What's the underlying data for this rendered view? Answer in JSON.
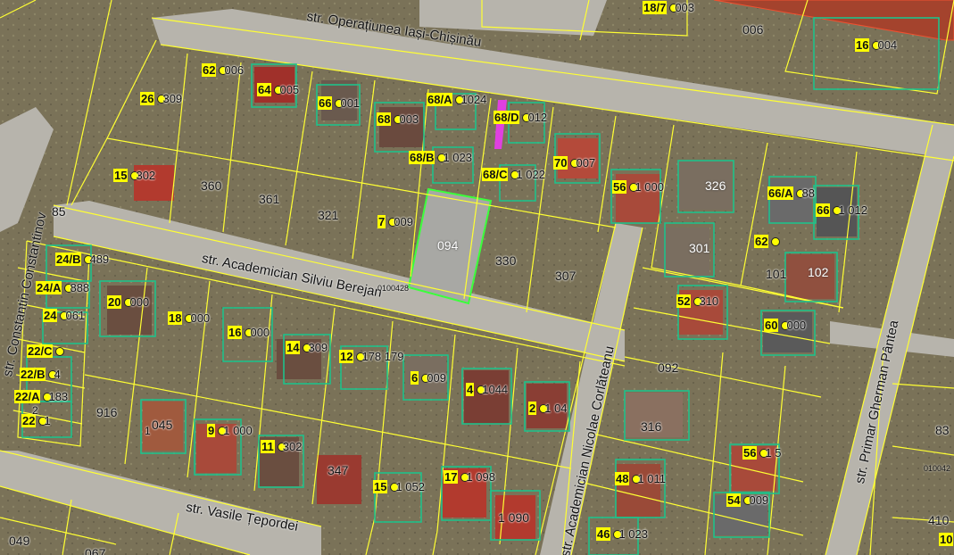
{
  "streets": [
    {
      "id": "operatiunea",
      "label": "str. Operațiunea Iași-Chișinău"
    },
    {
      "id": "berejan",
      "label": "str. Academician Silviu Berejan"
    },
    {
      "id": "corlateanu",
      "label": "str. Academician Nicolae Corlăteanu"
    },
    {
      "id": "constantinov",
      "label": "str. Constantin Constantinov"
    },
    {
      "id": "tepordei",
      "label": "str. Vasile Țepordei"
    },
    {
      "id": "pantea",
      "label": "str. Primar Gherman Pântea"
    }
  ],
  "plots": [
    "006",
    "360",
    "361",
    "321",
    "094",
    "330",
    "307",
    "326",
    "301",
    "101",
    "102",
    "092",
    "916",
    "347",
    "85",
    "049",
    "067",
    "83",
    "410"
  ],
  "sector_codes": [
    "0100428",
    "010042"
  ],
  "address_points": [
    {
      "num": "62",
      "sub": "006"
    },
    {
      "num": "64",
      "sub": "005"
    },
    {
      "num": "66",
      "sub": "001"
    },
    {
      "num": "68",
      "sub": "003"
    },
    {
      "num": "68/A",
      "sub": "1024"
    },
    {
      "num": "68/D",
      "sub": "012"
    },
    {
      "num": "26",
      "sub": "309"
    },
    {
      "num": "68/B",
      "sub": "1 023"
    },
    {
      "num": "68/C",
      "sub": "1 022"
    },
    {
      "num": "70",
      "sub": "007"
    },
    {
      "num": "56",
      "sub": "1 000"
    },
    {
      "num": "66/A",
      "sub": "88"
    },
    {
      "num": "66",
      "sub": "1 012"
    },
    {
      "num": "15",
      "sub": "302"
    },
    {
      "num": "7",
      "sub": "009"
    },
    {
      "num": "62",
      "sub": ""
    },
    {
      "num": "24/B",
      "sub": "489"
    },
    {
      "num": "24/A",
      "sub": "888"
    },
    {
      "num": "24",
      "sub": "061"
    },
    {
      "num": "20",
      "sub": "000"
    },
    {
      "num": "18",
      "sub": "000"
    },
    {
      "num": "16",
      "sub": "000"
    },
    {
      "num": "52",
      "sub": "310"
    },
    {
      "num": "60",
      "sub": "000"
    },
    {
      "num": "22/C",
      "sub": ""
    },
    {
      "num": "22/B",
      "sub": "4"
    },
    {
      "num": "22/A",
      "sub": "183"
    },
    {
      "num": "22",
      "sub": "1"
    },
    {
      "num": "14",
      "sub": "309"
    },
    {
      "num": "12",
      "sub": "178 179"
    },
    {
      "num": "6",
      "sub": "009"
    },
    {
      "num": "4",
      "sub": "1044"
    },
    {
      "num": "2",
      "sub": "1 04"
    },
    {
      "num": "9",
      "sub": "1 000"
    },
    {
      "num": "11",
      "sub": "302"
    },
    {
      "num": "15",
      "sub": "1 052"
    },
    {
      "num": "17",
      "sub": "1 098"
    },
    {
      "num": "48",
      "sub": "1 011"
    },
    {
      "num": "56",
      "sub": "1 5"
    },
    {
      "num": "54",
      "sub": "009"
    },
    {
      "num": "46",
      "sub": "1 023"
    },
    {
      "num": "16",
      "sub": "004"
    },
    {
      "num": "18/7",
      "sub": "003"
    },
    {
      "num": "10",
      "sub": ""
    }
  ],
  "extra_labels": [
    "1",
    "2",
    "045",
    "316",
    "1 090",
    "1 045"
  ],
  "colors": {
    "boundary": "#ffff33",
    "building": "#1fc18a",
    "highlight": "#3cff3c",
    "marker": "#ffff00",
    "reserved": "#e040e0"
  }
}
